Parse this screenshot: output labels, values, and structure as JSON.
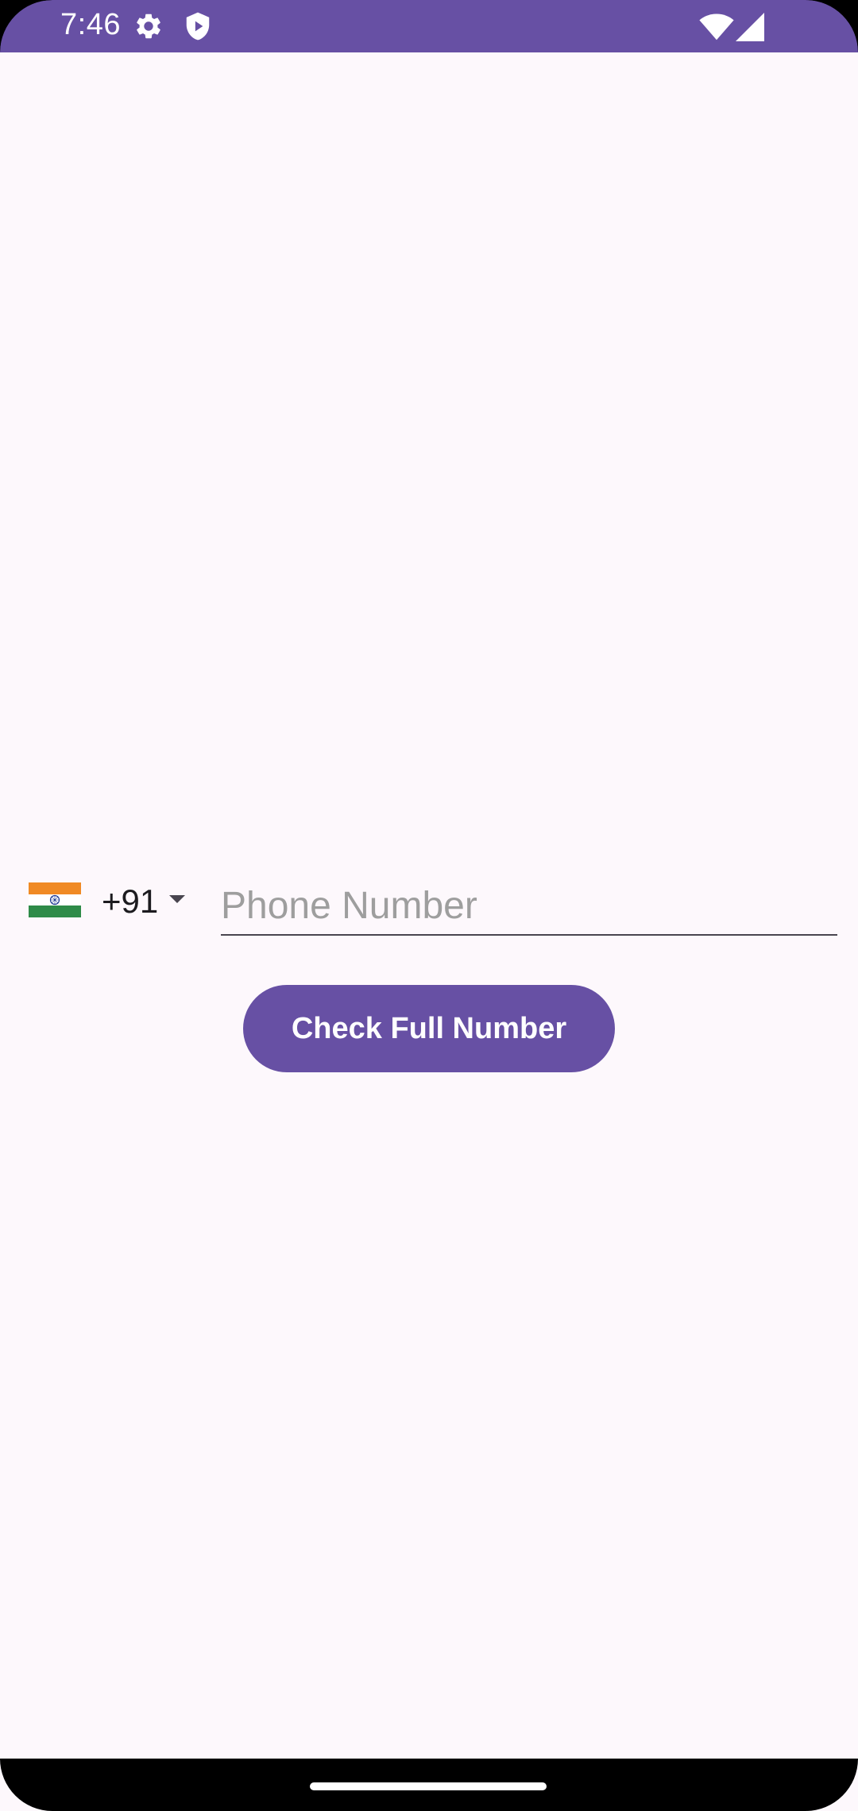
{
  "status_bar": {
    "time": "7:46",
    "icons": [
      "gear-icon",
      "play-protect-icon",
      "wifi-icon",
      "signal-icon"
    ]
  },
  "phone_form": {
    "country_flag": "india-flag-icon",
    "dial_code": "+91",
    "phone_placeholder": "Phone Number",
    "phone_value": "",
    "check_button_label": "Check Full Number"
  },
  "colors": {
    "primary": "#6750A4",
    "background": "#FDF8FC",
    "flag_saffron": "#F08A24",
    "flag_white": "#FFFFFF",
    "flag_green": "#2E8B48",
    "chakra_blue": "#1F3A93"
  }
}
